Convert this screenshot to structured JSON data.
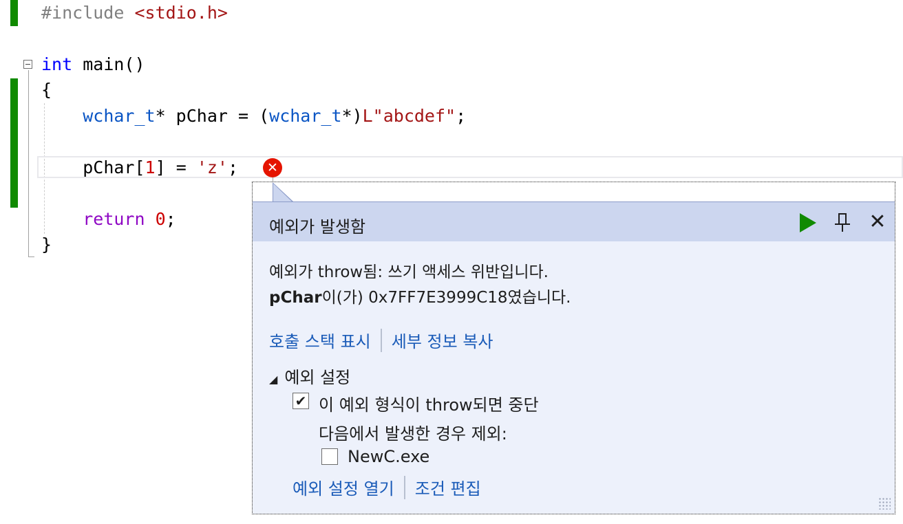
{
  "code": {
    "include_directive": "#include",
    "include_header": "<stdio.h>",
    "main_type": "int",
    "main_sig": "main()",
    "open_brace": "{",
    "line_decl": {
      "type": "wchar_t",
      "rest": "* pChar = (",
      "cast_type": "wchar_t",
      "cast_end": "*)",
      "literal": "L\"abcdef\"",
      "end": ";"
    },
    "line_assign": {
      "lhs": "pChar[",
      "index": "1",
      "mid": "] = ",
      "char_lit": "'z'",
      "end": ";"
    },
    "line_return": {
      "keyword": "return",
      "value": "0",
      "end": ";"
    },
    "close_brace": "}"
  },
  "popup": {
    "title": "예외가 발생함",
    "message_line1": "예외가 throw됨: 쓰기 액세스 위반입니다.",
    "message_var": "pChar",
    "message_line2_rest": "이(가) 0x7FF7E3999C18였습니다.",
    "link_call_stack": "호출 스택 표시",
    "link_copy_details": "세부 정보 복사",
    "settings_title": "예외 설정",
    "checkbox_break_label": "이 예외 형식이 throw되면 중단",
    "checkbox_break_checked": true,
    "except_when_label": "다음에서 발생한 경우 제외:",
    "checkbox_module_label": "NewC.exe",
    "checkbox_module_checked": false,
    "link_open_settings": "예외 설정 열기",
    "link_edit_conditions": "조건 편집",
    "close_glyph": "✕",
    "check_glyph": "✔"
  },
  "colors": {
    "change_bar": "#108a00",
    "error_icon": "#e51400",
    "popup_header": "#ccd6ef",
    "popup_body": "#edf1fb",
    "link": "#1a5bb8"
  },
  "icons": [
    "collapse-icon",
    "error-icon",
    "continue-icon",
    "pin-icon",
    "close-icon",
    "resize-grip-icon"
  ]
}
